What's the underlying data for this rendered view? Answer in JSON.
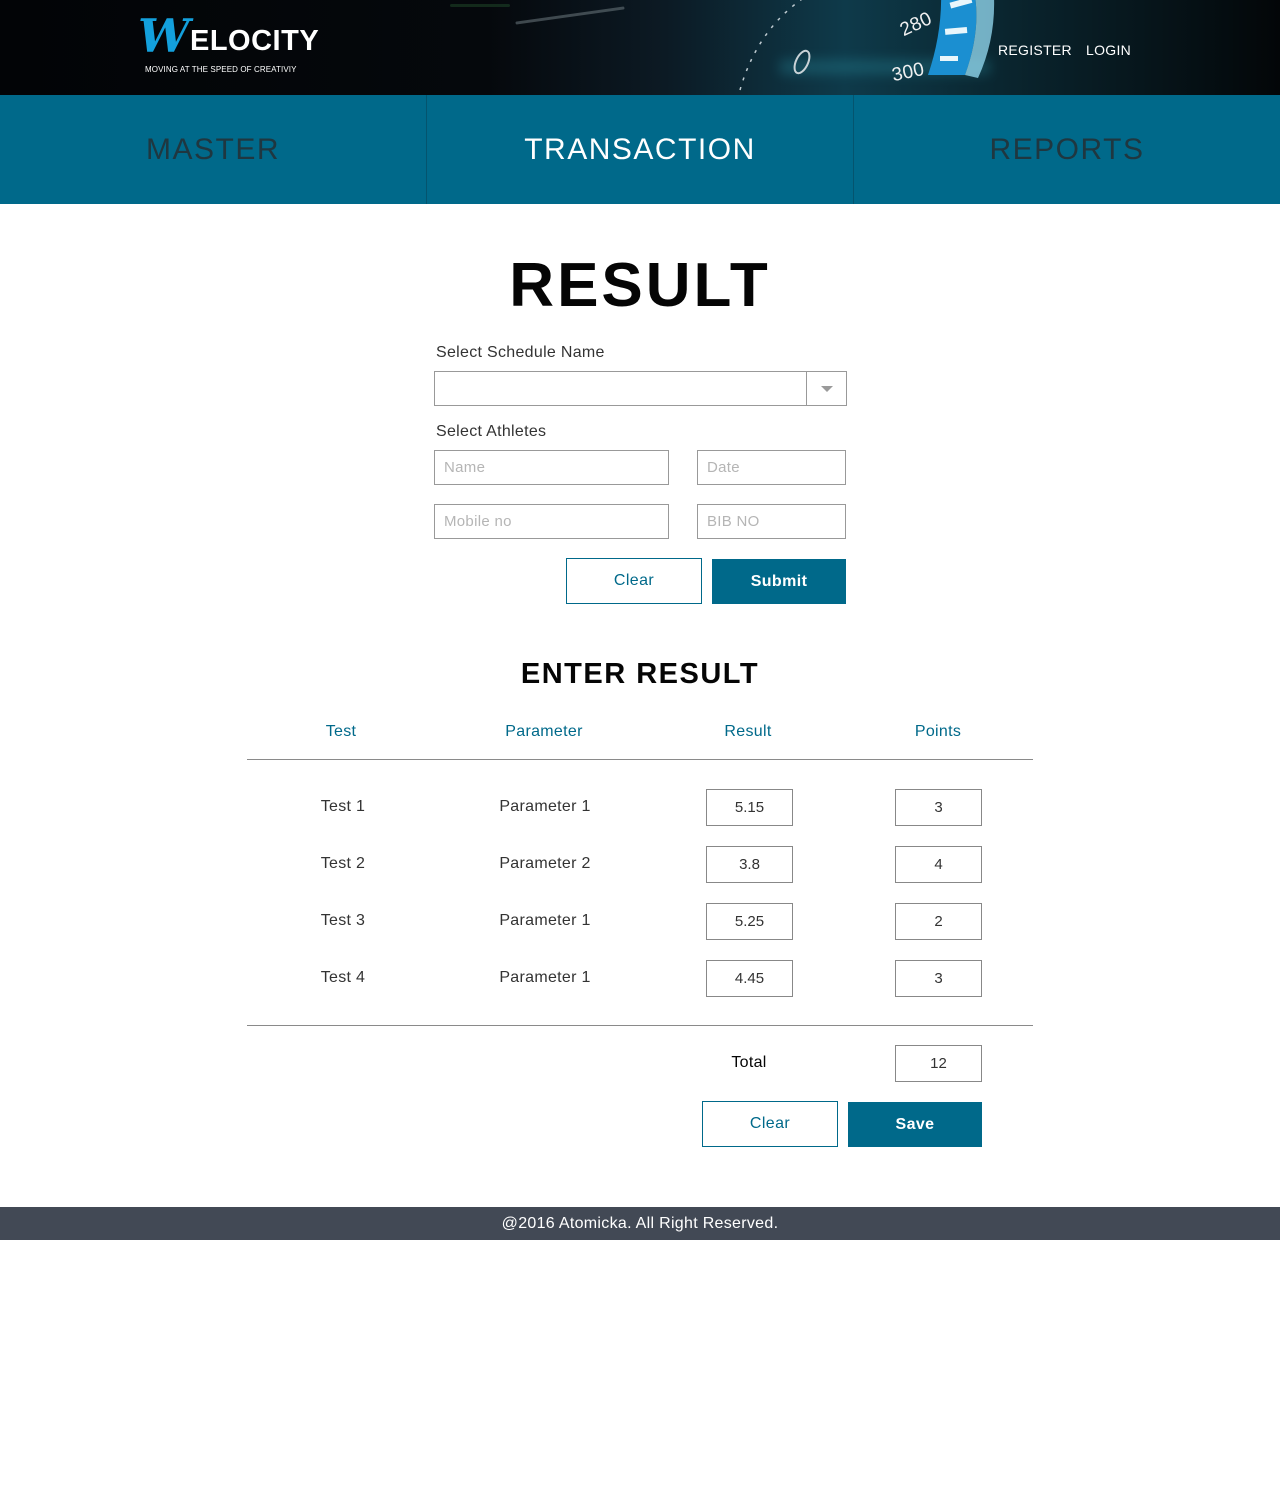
{
  "brand": {
    "logo_letter": "W",
    "logo_text": "ELOCITY",
    "tagline": "MOVING AT THE SPEED OF CREATIVIY"
  },
  "header": {
    "register_label": "REGISTER",
    "login_label": "LOGIN",
    "gauge_numbers": [
      "280",
      "300"
    ]
  },
  "nav": {
    "items": [
      {
        "label": "MASTER",
        "active": false
      },
      {
        "label": "TRANSACTION",
        "active": true
      },
      {
        "label": "REPORTS",
        "active": false
      }
    ]
  },
  "page": {
    "title": "RESULT"
  },
  "filter": {
    "schedule_label": "Select Schedule Name",
    "schedule_value": "",
    "athletes_label": "Select Athletes",
    "name_placeholder": "Name",
    "date_placeholder": "Date",
    "mobile_placeholder": "Mobile no",
    "bib_placeholder": "BIB NO",
    "clear_label": "Clear",
    "submit_label": "Submit"
  },
  "results": {
    "title": "ENTER RESULT",
    "columns": [
      "Test",
      "Parameter",
      "Result",
      "Points"
    ],
    "rows": [
      {
        "test": "Test 1",
        "parameter": "Parameter 1",
        "result": "5.15",
        "points": "3"
      },
      {
        "test": "Test 2",
        "parameter": "Parameter 2",
        "result": "3.8",
        "points": "4"
      },
      {
        "test": "Test 3",
        "parameter": "Parameter 1",
        "result": "5.25",
        "points": "2"
      },
      {
        "test": "Test 4",
        "parameter": "Parameter 1",
        "result": "4.45",
        "points": "3"
      }
    ],
    "total_label": "Total",
    "total_value": "12",
    "clear_label": "Clear",
    "save_label": "Save"
  },
  "footer": {
    "text": "@2016 Atomicka. All Right Reserved."
  },
  "colors": {
    "primary": "#00698a",
    "header_bg": "#020406",
    "footer_bg": "#424955",
    "logo_blue": "#13a0dc",
    "nav_text": "#1f3740"
  }
}
